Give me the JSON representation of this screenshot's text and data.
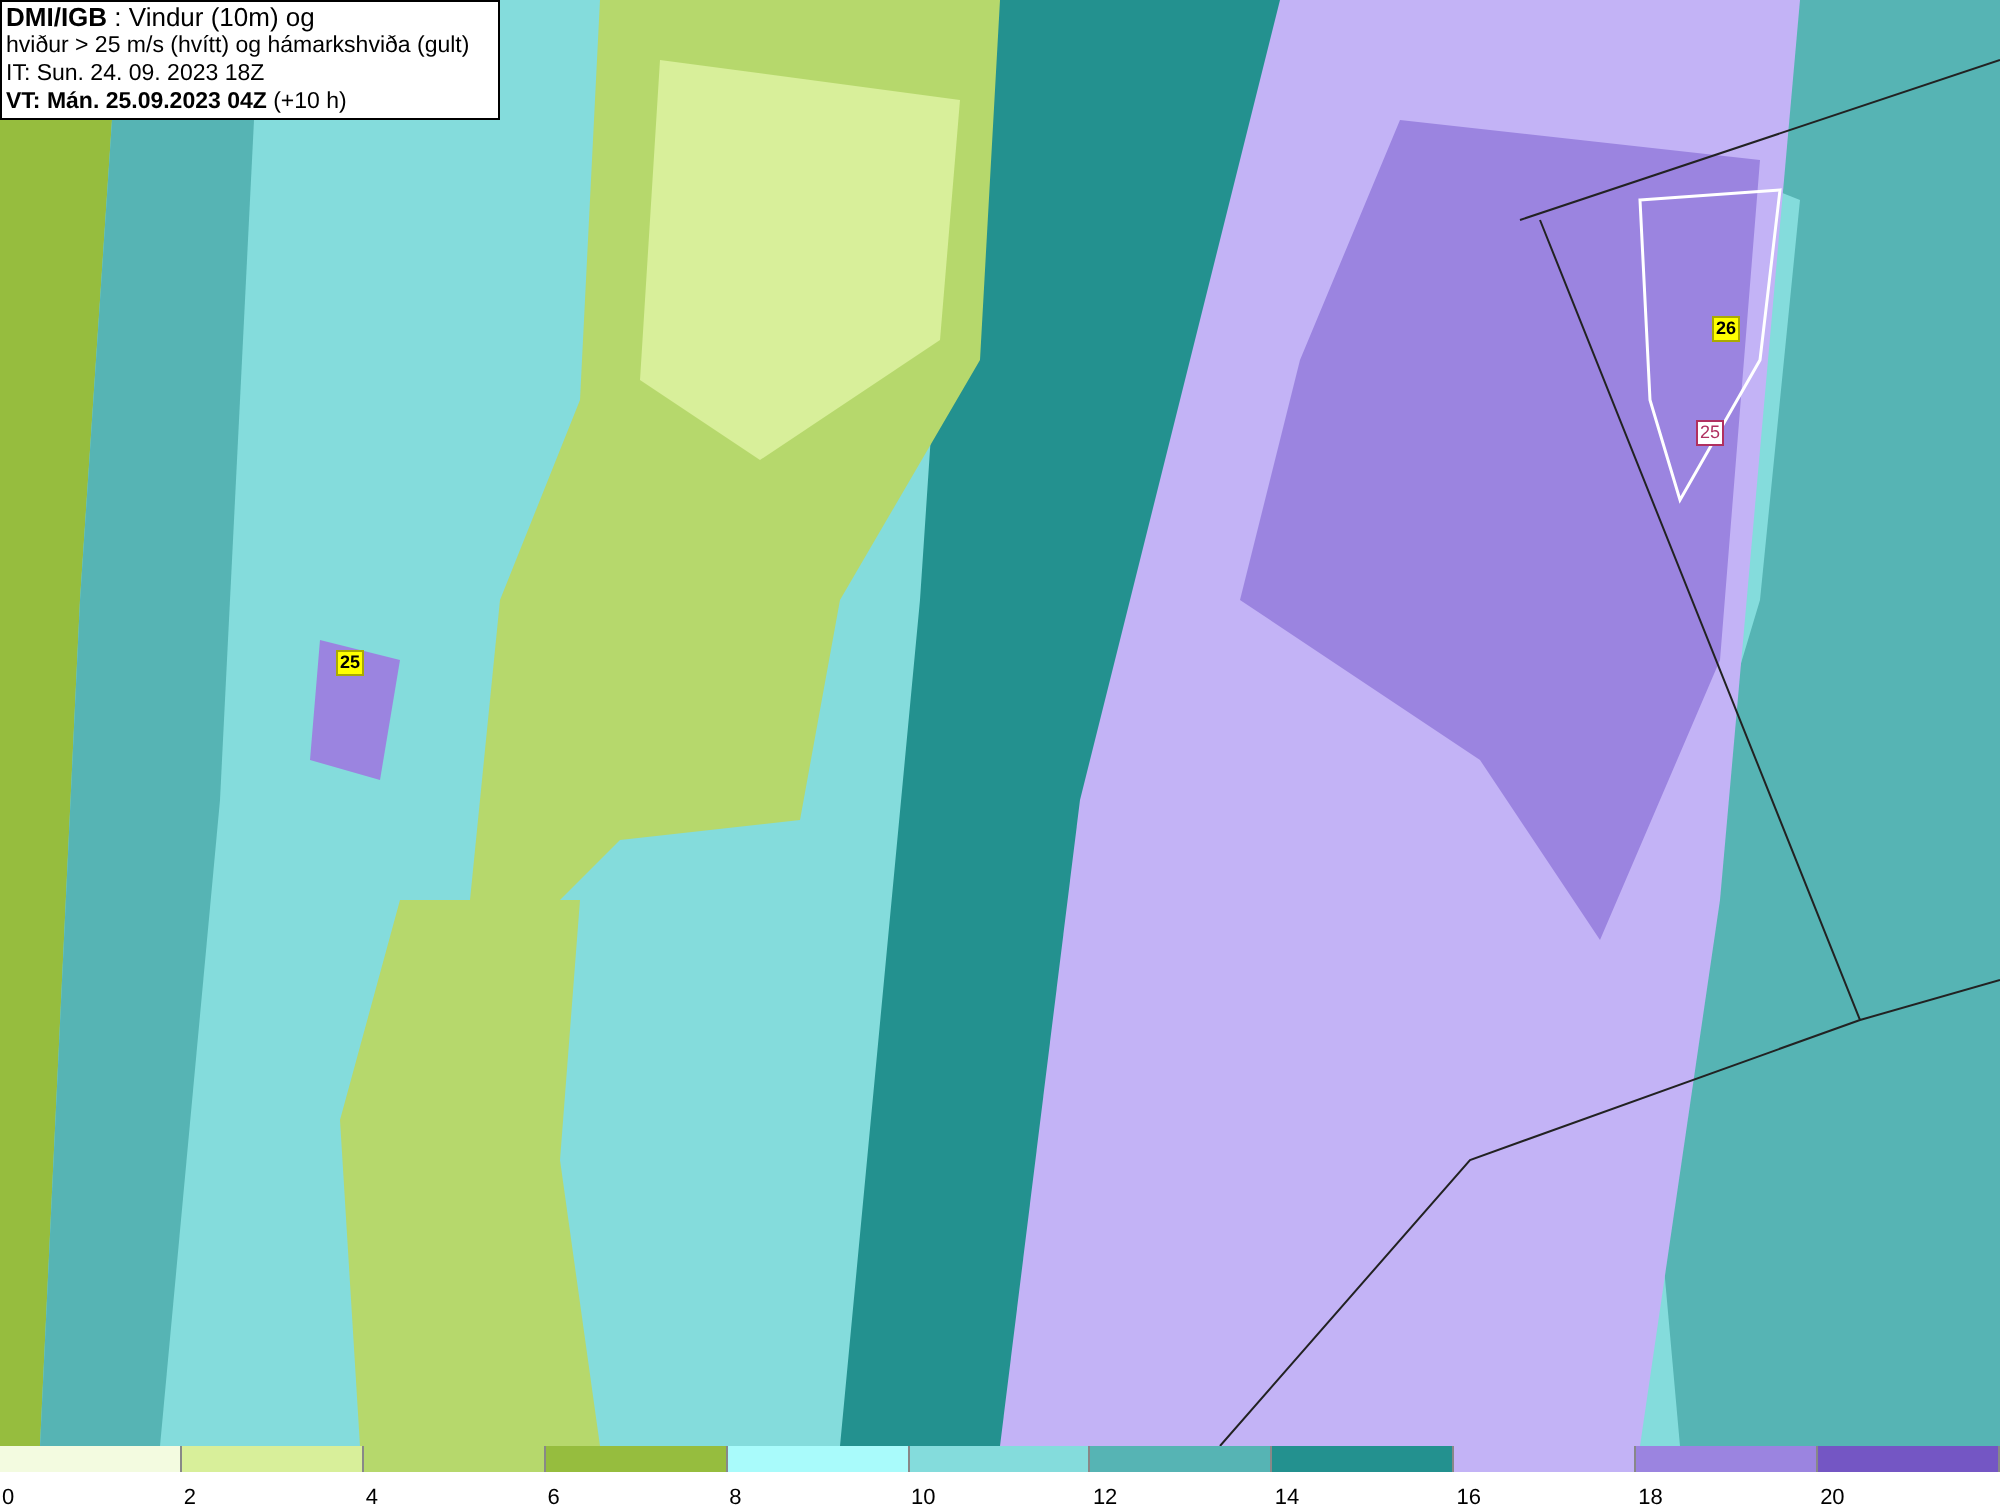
{
  "title_box": {
    "lines": [
      "**DMI/IGB** : Vindur (10m) og",
      "hviður > 25 m/s (hvítt) og hámarkshviða (gult)",
      "IT: Sun. 24. 09. 2023 18Z",
      "**VT: Mán. 25.09.2023 04Z** (+10 h)"
    ]
  },
  "map_labels": [
    {
      "text": "25",
      "kind": "max"
    },
    {
      "text": "26",
      "kind": "max"
    },
    {
      "text": "25",
      "kind": "contour"
    }
  ],
  "legend": {
    "segments": [
      {
        "color": "#f3fbe0"
      },
      {
        "color": "#d8ef9a"
      },
      {
        "color": "#b6d86c"
      },
      {
        "color": "#96bd3e"
      },
      {
        "color": "#a9fbfb"
      },
      {
        "color": "#84dcdc"
      },
      {
        "color": "#56b4b4"
      },
      {
        "color": "#23918f"
      },
      {
        "color": "#c3b3f6"
      },
      {
        "color": "#9b84e0"
      },
      {
        "color": "#7456c4"
      }
    ],
    "ticks": [
      "0",
      "2",
      "4",
      "6",
      "8",
      "10",
      "12",
      "14",
      "16",
      "18",
      "20"
    ]
  }
}
